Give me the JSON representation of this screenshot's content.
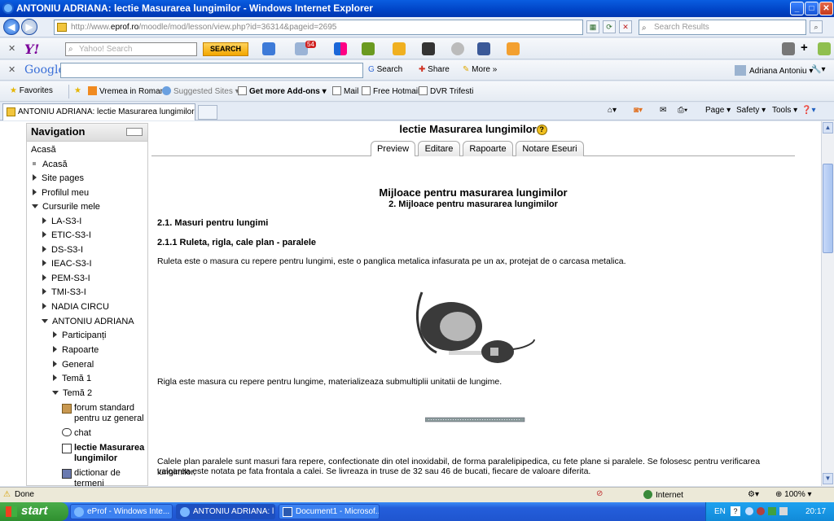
{
  "window": {
    "title": "ANTONIU ADRIANA: lectie Masurarea lungimilor - Windows Internet Explorer",
    "minimize": "_",
    "maximize": "□",
    "close": "✕"
  },
  "address": {
    "url_prefix": "http://www.",
    "url_domain": "eprof.ro",
    "url_rest": "/moodle/mod/lesson/view.php?id=36314&pageid=2695",
    "search_placeholder": "Search Results"
  },
  "yahoo_toolbar": {
    "logo": "Y!",
    "search_placeholder": "Yahoo! Search",
    "search_button": "SEARCH",
    "mail_badge": "54"
  },
  "google_toolbar": {
    "logo": "Google",
    "search_label": "Search",
    "share_label": "Share",
    "more_label": "More »",
    "user_name": "Adriana Antoniu"
  },
  "favorites_bar": {
    "favorites_label": "Favorites",
    "items": [
      "Vremea in Roman",
      "Suggested Sites",
      "Get more Add-ons",
      "Mail",
      "Free Hotmail",
      "DVR Trifesti"
    ]
  },
  "tab": {
    "title": "ANTONIU ADRIANA: lectie Masurarea lungimilor"
  },
  "command_bar": {
    "page_label": "Page",
    "safety_label": "Safety",
    "tools_label": "Tools"
  },
  "navigation": {
    "header": "Navigation",
    "items": [
      {
        "label": "Acasă"
      },
      {
        "label": "Acasă"
      },
      {
        "label": "Site pages"
      },
      {
        "label": "Profilul meu"
      },
      {
        "label": "Cursurile mele"
      },
      {
        "label": "LA-S3-I"
      },
      {
        "label": "ETIC-S3-I"
      },
      {
        "label": "DS-S3-I"
      },
      {
        "label": "IEAC-S3-I"
      },
      {
        "label": "PEM-S3-I"
      },
      {
        "label": "TMI-S3-I"
      },
      {
        "label": "NADIA CIRCU"
      },
      {
        "label": "ANTONIU ADRIANA"
      },
      {
        "label": "Participanți"
      },
      {
        "label": "Rapoarte"
      },
      {
        "label": "General"
      },
      {
        "label": "Temă 1"
      },
      {
        "label": "Temă 2"
      },
      {
        "label": "forum standard pentru uz general"
      },
      {
        "label": "chat"
      },
      {
        "label": "lectie Masurarea lungimilor"
      },
      {
        "label": "dictionar de termeni"
      }
    ]
  },
  "lesson": {
    "title": "lectie Masurarea lungimilor",
    "help": "?",
    "tabs": [
      "Preview",
      "Editare",
      "Rapoarte",
      "Notare Eseuri"
    ],
    "heading": "Mijloace pentru masurarea lungimilor",
    "subheading": "2. Mijloace pentru masurarea lungimilor",
    "section1": "2.1. Masuri pentru lungimi",
    "section2": "2.1.1 Ruleta, rigla, cale plan - paralele",
    "para1": "Ruleta este o masura cu repere pentru lungimi, este o panglica metalica infasurata pe un ax, protejat de o carcasa metalica.",
    "para2": "Rigla este masura cu repere pentru lungime, materializeaza submultiplii unitatii de lungime.",
    "para3_line1": "Calele plan paralele sunt masuri fara repere, confectionate din otel inoxidabil, de forma paralelipipedica, cu fete plane si paralele. Se folosesc pentru verificarea lungimilor,",
    "para3_line2": "valoarea este notata pe fata frontala a calei. Se livreaza in truse de 32 sau 46 de bucati, fiecare de valoare diferita."
  },
  "status": {
    "text": "Done",
    "zone": "Internet",
    "zoom": "100%"
  },
  "taskbar": {
    "start": "start",
    "tasks": [
      "eProf - Windows Inte...",
      "ANTONIU ADRIANA: l...",
      "Document1 - Microsof..."
    ],
    "lang": "EN",
    "time": "20:17"
  }
}
